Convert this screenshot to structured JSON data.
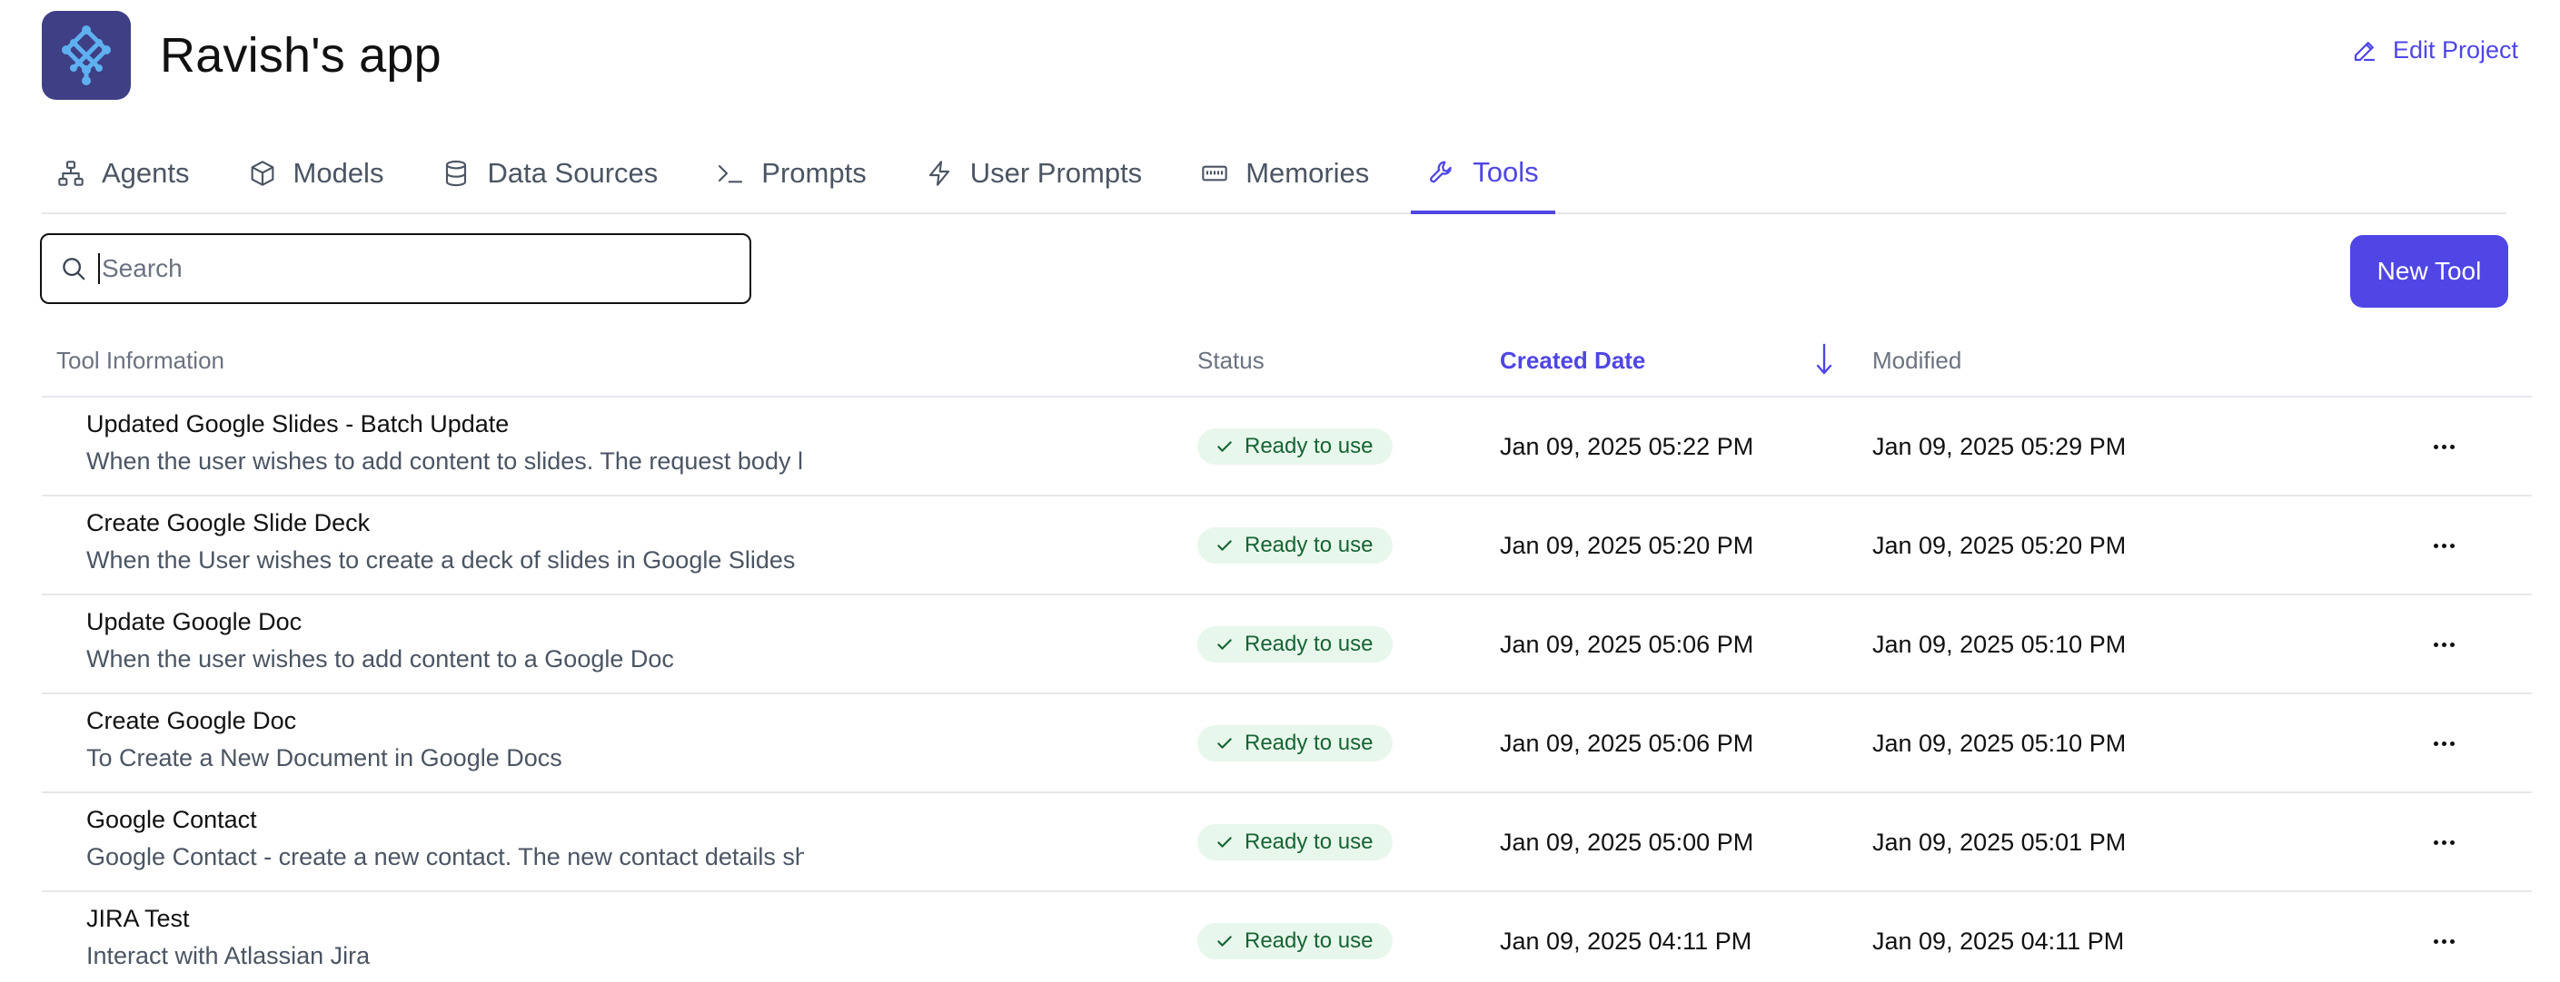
{
  "app": {
    "title": "Ravish's app",
    "edit_project_label": "Edit Project",
    "accent_color": "#4f46e5"
  },
  "tabs": [
    {
      "label": "Agents",
      "icon": "network-icon",
      "active": false
    },
    {
      "label": "Models",
      "icon": "cube-icon",
      "active": false
    },
    {
      "label": "Data Sources",
      "icon": "database-icon",
      "active": false
    },
    {
      "label": "Prompts",
      "icon": "terminal-icon",
      "active": false
    },
    {
      "label": "User Prompts",
      "icon": "bolt-icon",
      "active": false
    },
    {
      "label": "Memories",
      "icon": "memory-icon",
      "active": false
    },
    {
      "label": "Tools",
      "icon": "wrench-icon",
      "active": true
    }
  ],
  "search": {
    "placeholder": "Search",
    "value": ""
  },
  "new_tool_label": "New Tool",
  "table": {
    "columns": {
      "tool_information": "Tool Information",
      "status": "Status",
      "created_date": "Created Date",
      "modified": "Modified"
    },
    "sort": {
      "column": "created_date",
      "direction": "descending"
    },
    "rows": [
      {
        "name": "Updated Google Slides - Batch Update",
        "description": "When the user wishes to add content to slides. The request body looks like the following, use the",
        "status": "Ready to use",
        "created": "Jan 09, 2025 05:22 PM",
        "modified": "Jan 09, 2025 05:29 PM"
      },
      {
        "name": "Create Google Slide Deck",
        "description": "When the User wishes to create a deck of slides in Google Slides",
        "status": "Ready to use",
        "created": "Jan 09, 2025 05:20 PM",
        "modified": "Jan 09, 2025 05:20 PM"
      },
      {
        "name": "Update Google Doc",
        "description": "When the user wishes to add content to a Google Doc",
        "status": "Ready to use",
        "created": "Jan 09, 2025 05:06 PM",
        "modified": "Jan 09, 2025 05:10 PM"
      },
      {
        "name": "Create Google Doc",
        "description": "To Create a New Document in Google Docs",
        "status": "Ready to use",
        "created": "Jan 09, 2025 05:06 PM",
        "modified": "Jan 09, 2025 05:10 PM"
      },
      {
        "name": "Google Contact",
        "description": "Google Contact - create a new contact. The new contact details should be formatted as following",
        "status": "Ready to use",
        "created": "Jan 09, 2025 05:00 PM",
        "modified": "Jan 09, 2025 05:01 PM"
      },
      {
        "name": "JIRA Test",
        "description": "Interact with Atlassian Jira",
        "status": "Ready to use",
        "created": "Jan 09, 2025 04:11 PM",
        "modified": "Jan 09, 2025 04:11 PM"
      }
    ]
  }
}
